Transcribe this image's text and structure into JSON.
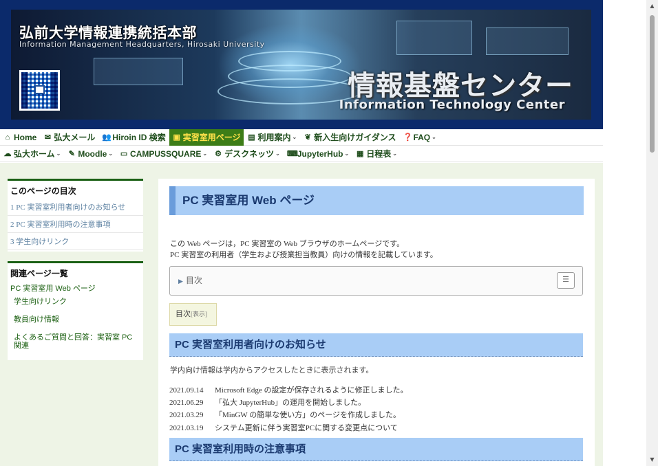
{
  "banner": {
    "title_ja": "弘前大学情報連携統括本部",
    "title_en": "Information Management Headquarters, Hirosaki University",
    "center_ja": "情報基盤センター",
    "center_en": "Information Technology Center"
  },
  "nav1": [
    {
      "label": "Home",
      "icon": "home-icon",
      "caret": false,
      "active": false
    },
    {
      "label": "弘大メール",
      "icon": "mail-icon",
      "caret": false,
      "active": false
    },
    {
      "label": "Hiroin ID 検索",
      "icon": "users-icon",
      "caret": false,
      "active": false
    },
    {
      "label": "実習室用ページ",
      "icon": "computer-lab-icon",
      "caret": false,
      "active": true
    },
    {
      "label": "利用案内",
      "icon": "document-icon",
      "caret": true,
      "active": false
    },
    {
      "label": "新入生向けガイダンス",
      "icon": "sprout-icon",
      "caret": false,
      "active": false
    },
    {
      "label": "FAQ",
      "icon": "question-icon",
      "caret": true,
      "active": false
    }
  ],
  "nav2": [
    {
      "label": "弘大ホーム",
      "icon": "cloud-icon",
      "caret": true
    },
    {
      "label": "Moodle",
      "icon": "moodle-icon",
      "caret": true
    },
    {
      "label": "CAMPUSSQUARE",
      "icon": "monitor-icon",
      "caret": true
    },
    {
      "label": "デスクネッツ",
      "icon": "user-gear-icon",
      "caret": true
    },
    {
      "label": "JupyterHub",
      "icon": "keyboard-icon",
      "caret": true
    },
    {
      "label": "日程表",
      "icon": "calendar-icon",
      "caret": true
    }
  ],
  "sidebar": {
    "toc_title": "このページの目次",
    "toc_items": [
      "1 PC 実習室利用者向けのお知らせ",
      "2 PC 実習室利用時の注意事項",
      "3 学生向けリンク"
    ],
    "related_title": "関連ページ一覧",
    "related_top": "PC 実習室用 Web ページ",
    "related_items": [
      "学生向けリンク",
      "教員向け情報",
      "よくあるご質問と回答：実習室 PC 関連"
    ]
  },
  "main": {
    "heading": "PC 実習室用 Web ページ",
    "intro_line1": "この Web ページは，PC 実習室の Web ブラウザのホームページです。",
    "intro_line2": "PC 実習室の利用者（学生および授業担当教員）向けの情報を記載しています。",
    "toc_label": "目次",
    "toc_small_label": "目次",
    "toc_small_show": "[表示]",
    "section1_title": "PC 実習室利用者向けのお知らせ",
    "section1_note": "学内向け情報は学内からアクセスしたときに表示されます。",
    "news": [
      {
        "date": "2021.09.14",
        "text": "Microsoft Edge の設定が保存されるように修正しました。"
      },
      {
        "date": "2021.06.29",
        "text": "「弘大 JupyterHub」の運用を開始しました。"
      },
      {
        "date": "2021.03.29",
        "text": "「MinGW の簡単な使い方」のページを作成しました。"
      },
      {
        "date": "2021.03.19",
        "text": "システム更新に伴う実習室PCに関する変更点について"
      }
    ],
    "section2_title": "PC 実習室利用時の注意事項"
  }
}
